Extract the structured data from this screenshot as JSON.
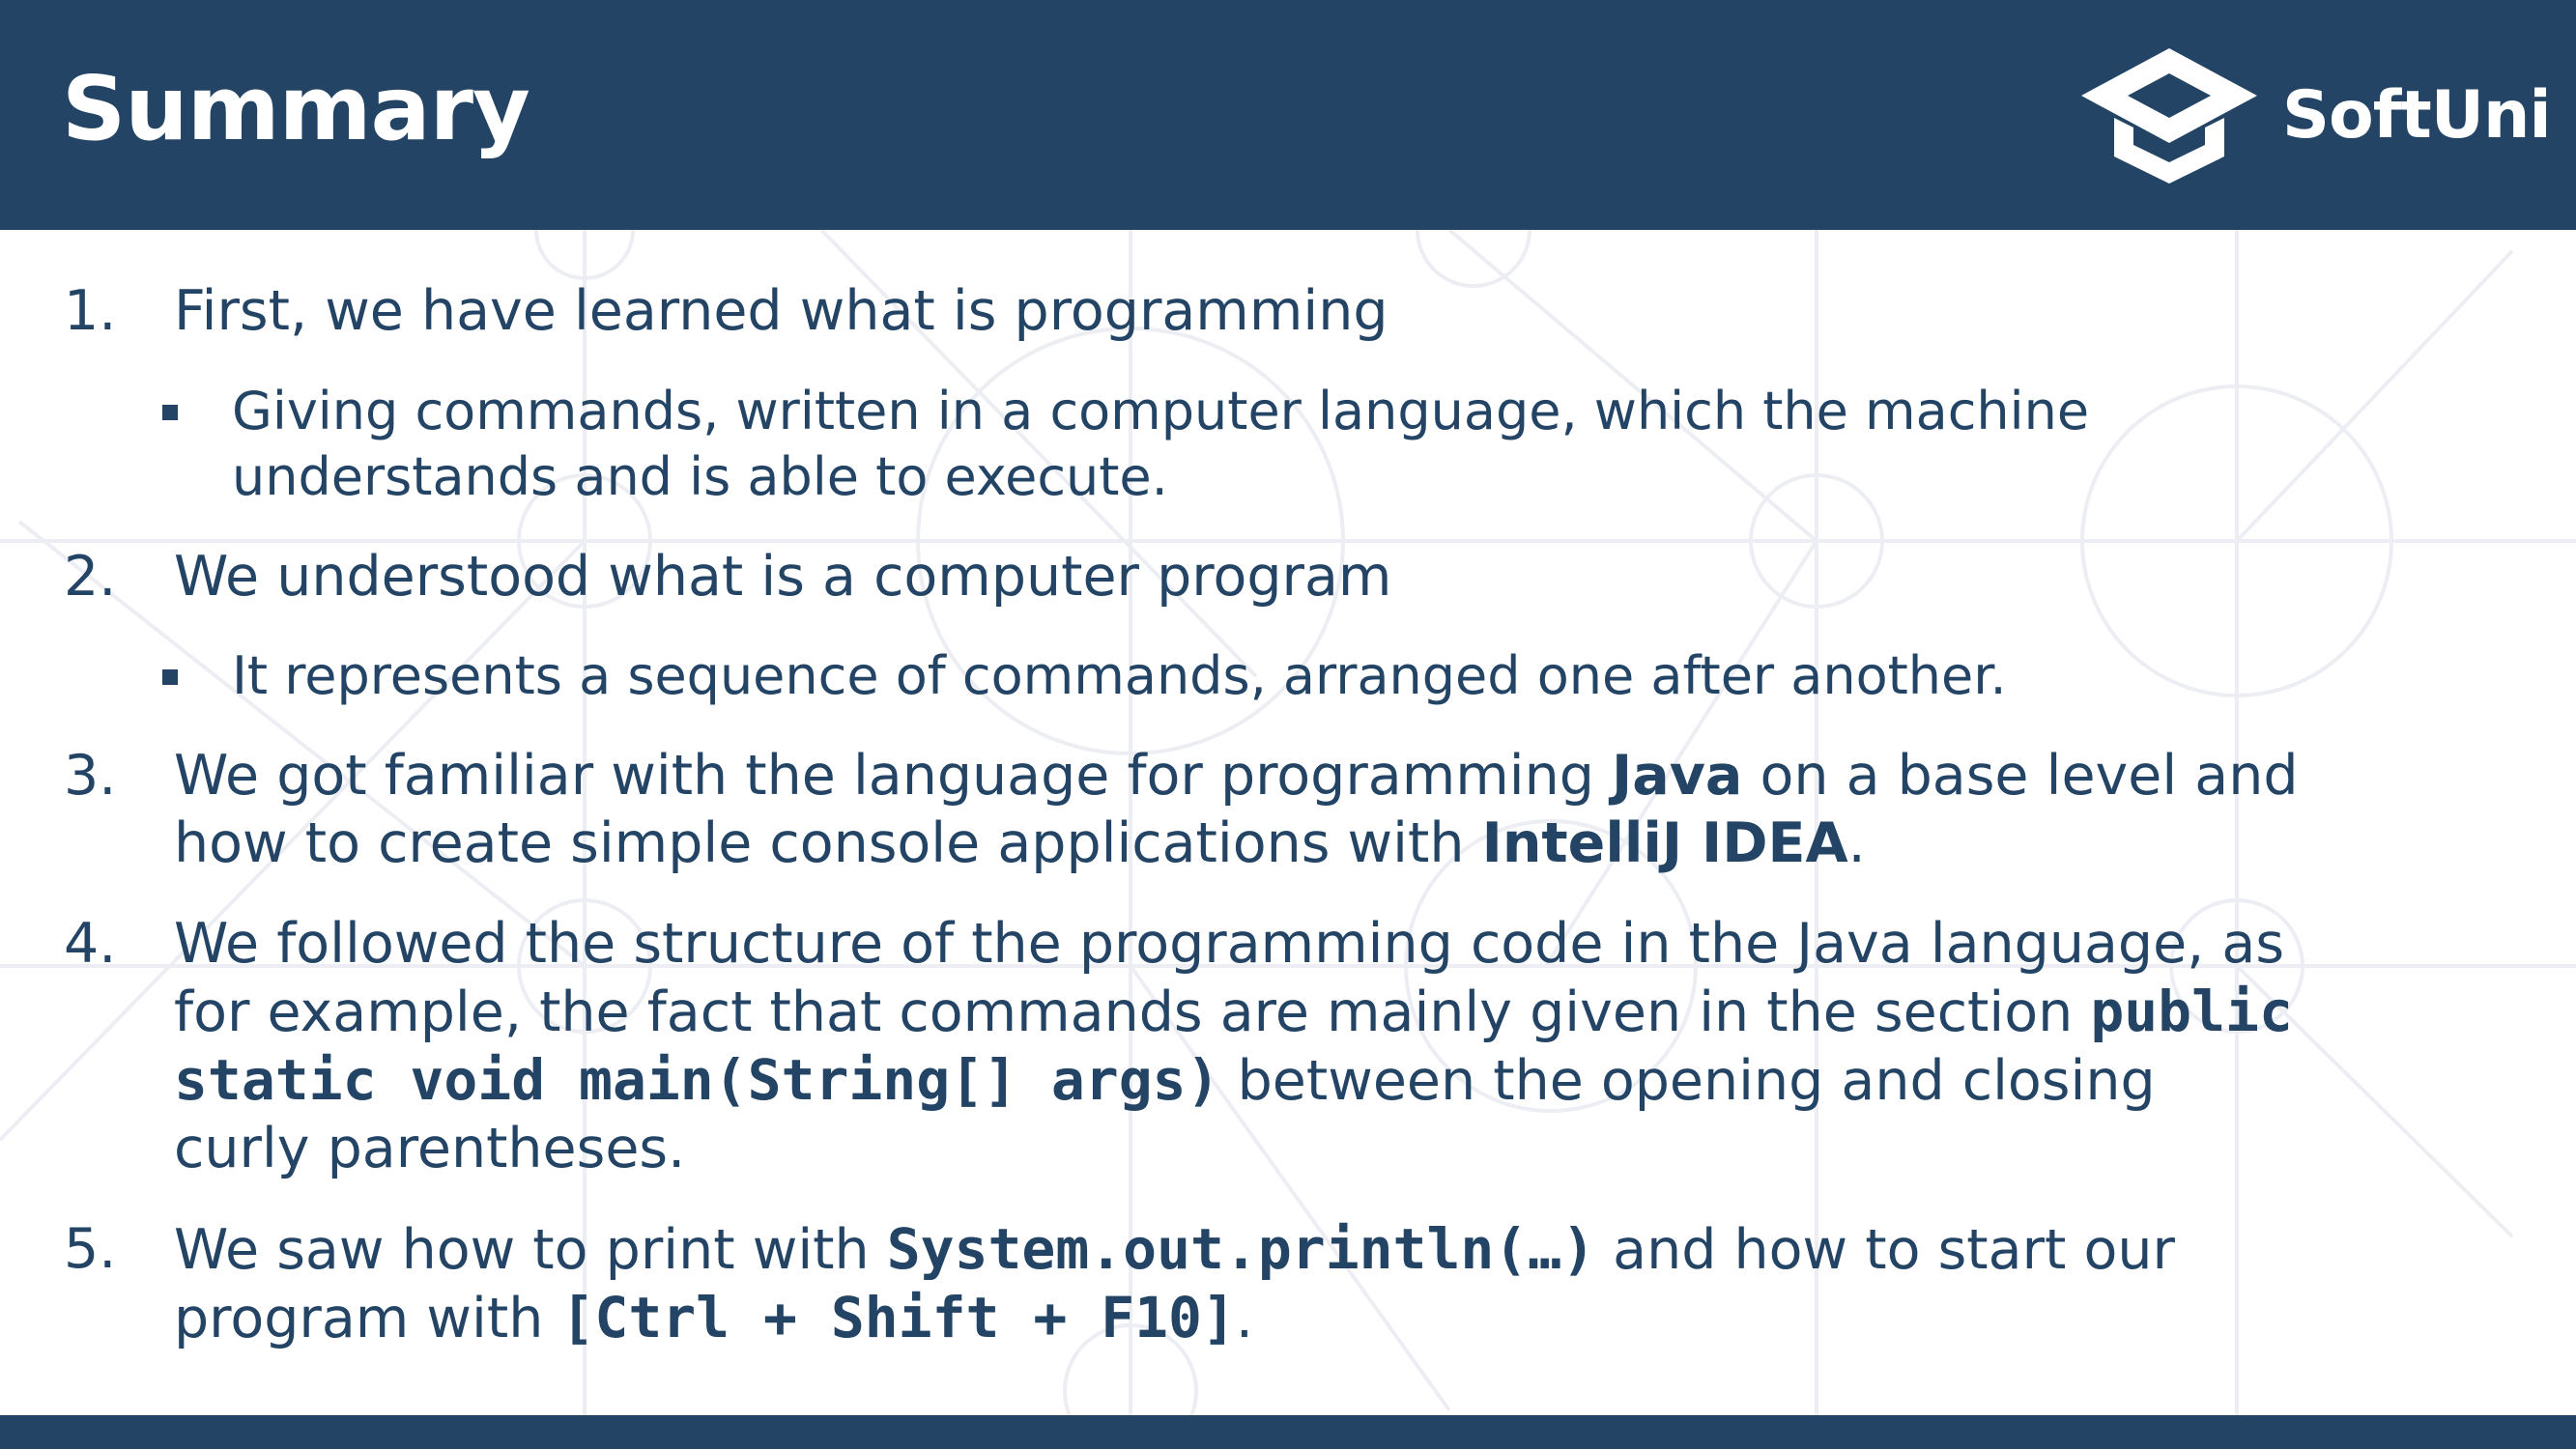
{
  "header": {
    "title": "Summary"
  },
  "logo": {
    "text": "SoftUni",
    "icon": "graduation-cap-icon"
  },
  "colors": {
    "primary": "#234465",
    "background": "#ffffff"
  },
  "items": [
    {
      "number": "1.",
      "text": "First, we have learned what is programming"
    },
    {
      "number": "2.",
      "text": "We understood what is a computer program"
    },
    {
      "number": "3.",
      "text_before": "We got familiar with the language for programming ",
      "bold1": "Java",
      "text_mid": " on a base level and how to create simple console applications with ",
      "bold2": "IntelliJ IDEA",
      "text_after": "."
    },
    {
      "number": "4.",
      "text_before": "We followed the structure of the programming code in the Java language, as for example, the fact that commands are mainly given in the section ",
      "code": "public static void main(String[] args)",
      "text_after": " between the opening and closing curly parentheses."
    },
    {
      "number": "5.",
      "text_before": "We saw how to print with ",
      "code1": "System.out.println(…)",
      "text_mid": " and how to start our program with ",
      "code2": "[Ctrl + Shift + F10]",
      "text_after": "."
    }
  ],
  "subitems": [
    {
      "text": "Giving commands, written in a computer language, which the machine understands and is able to execute."
    },
    {
      "text": "It represents a sequence of commands, arranged one after another."
    }
  ]
}
